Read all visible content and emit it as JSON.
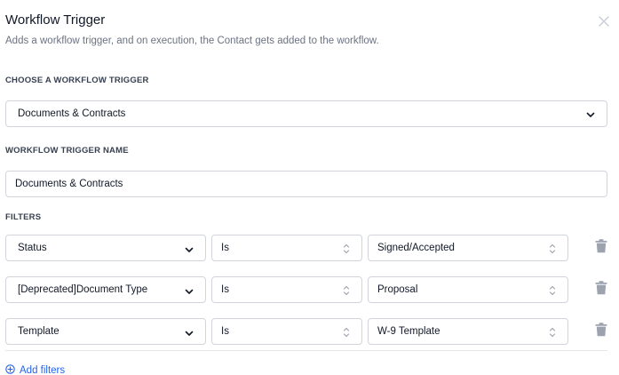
{
  "header": {
    "title": "Workflow Trigger",
    "subtitle": "Adds a workflow trigger, and on execution, the Contact gets added to the workflow.",
    "close_icon": "close-icon"
  },
  "trigger": {
    "label": "CHOOSE A WORKFLOW TRIGGER",
    "selected": "Documents & Contracts"
  },
  "trigger_name": {
    "label": "WORKFLOW TRIGGER NAME",
    "value": "Documents & Contracts"
  },
  "filters": {
    "label": "FILTERS",
    "rows": [
      {
        "field": "Status",
        "operator": "Is",
        "value": "Signed/Accepted"
      },
      {
        "field": "[Deprecated]Document Type",
        "operator": "Is",
        "value": "Proposal"
      },
      {
        "field": "Template",
        "operator": "Is",
        "value": "W-9 Template"
      }
    ],
    "add_label": "Add filters"
  },
  "colors": {
    "accent": "#2563eb",
    "border": "#d1d5db",
    "muted": "#6b7280",
    "trash": "#9ca3af"
  }
}
